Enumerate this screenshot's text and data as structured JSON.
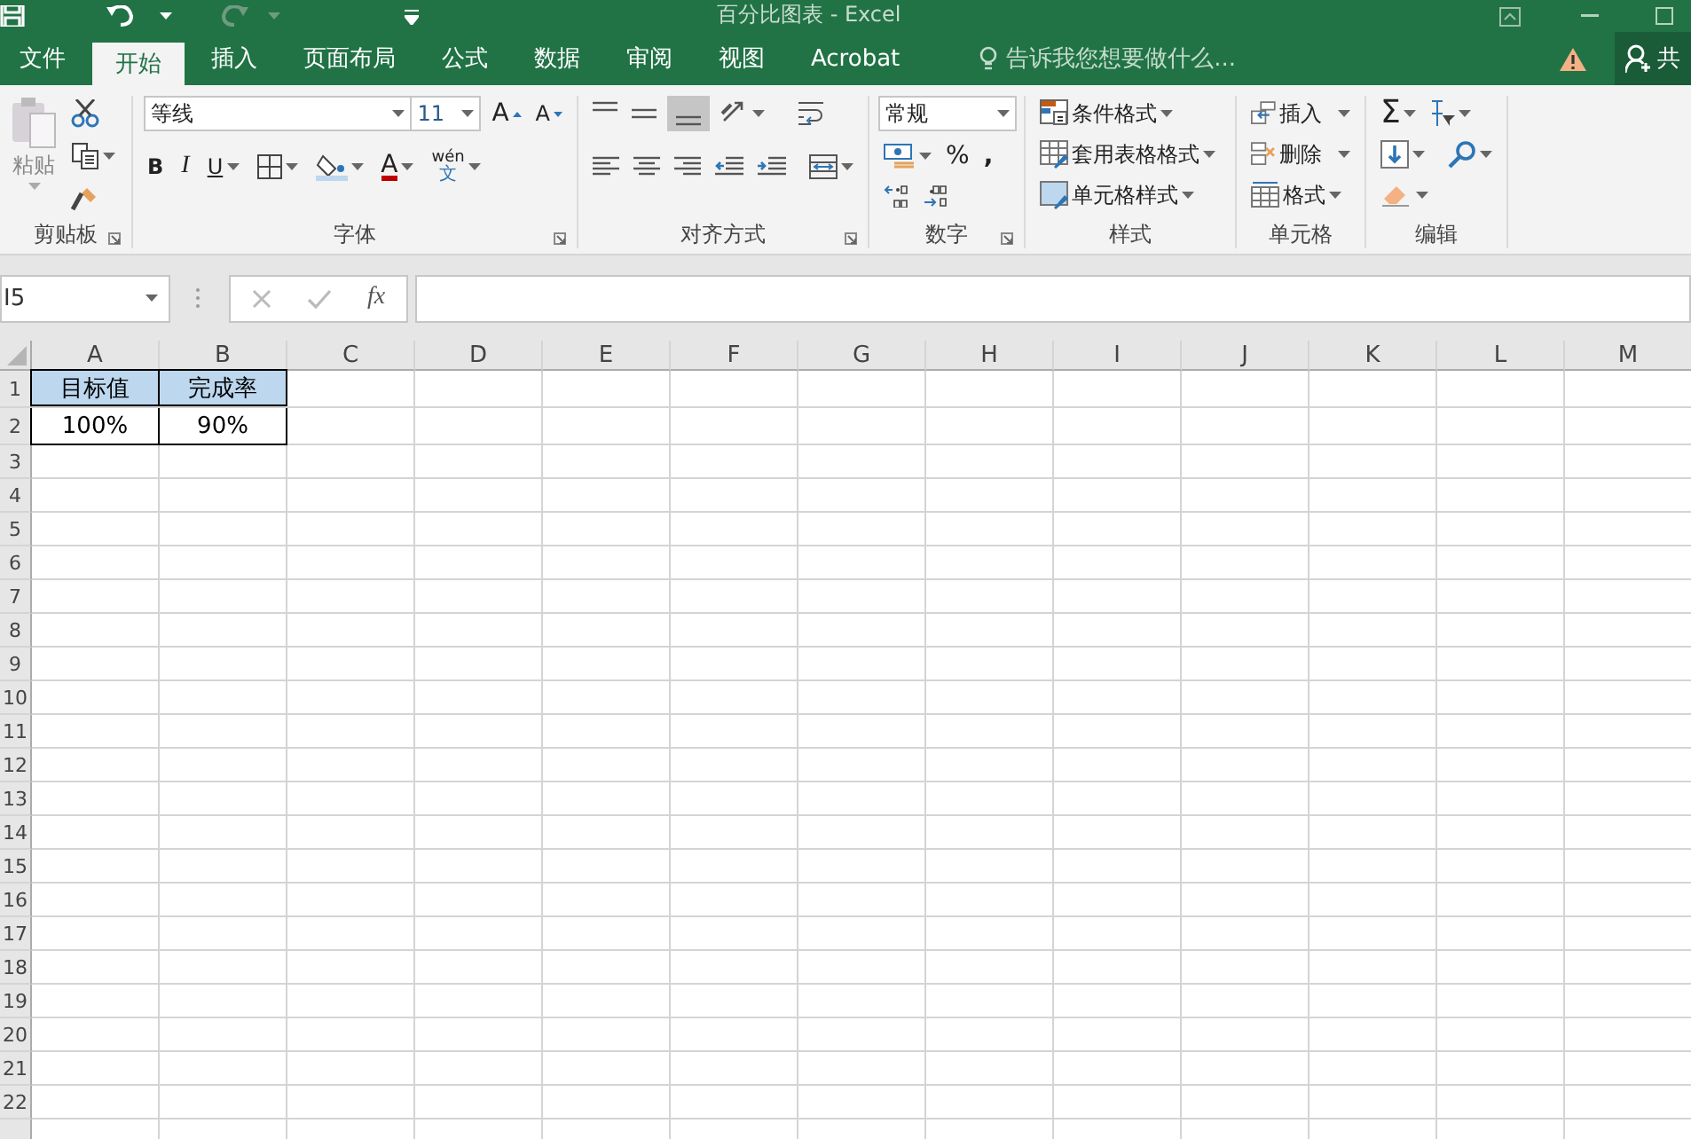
{
  "window": {
    "title": "百分比图表 - Excel"
  },
  "tabs": [
    {
      "label": "文件",
      "selected": false
    },
    {
      "label": "开始",
      "selected": true
    },
    {
      "label": "插入",
      "selected": false
    },
    {
      "label": "页面布局",
      "selected": false
    },
    {
      "label": "公式",
      "selected": false
    },
    {
      "label": "数据",
      "selected": false
    },
    {
      "label": "审阅",
      "selected": false
    },
    {
      "label": "视图",
      "selected": false
    },
    {
      "label": "Acrobat",
      "selected": false
    }
  ],
  "tell_me": {
    "placeholder": "告诉我您想要做什么..."
  },
  "share": {
    "label": "共"
  },
  "ribbon": {
    "clipboard": {
      "label": "剪贴板",
      "paste": "粘贴"
    },
    "font": {
      "label": "字体",
      "name": "等线",
      "size": "11",
      "grow": "A",
      "shrink": "A",
      "bold": "B",
      "italic": "I",
      "underline": "U",
      "font_color": "A",
      "phonetic": "wén",
      "phonetic_char": "文"
    },
    "alignment": {
      "label": "对齐方式"
    },
    "number": {
      "label": "数字",
      "format": "常规",
      "percent": "%",
      "comma": ","
    },
    "styles": {
      "label": "样式",
      "items": [
        "条件格式",
        "套用表格格式",
        "单元格样式"
      ]
    },
    "cells": {
      "label": "单元格",
      "items": [
        "插入",
        "删除",
        "格式"
      ]
    },
    "editing": {
      "label": "编辑",
      "autosum": "Σ"
    }
  },
  "formula_bar": {
    "name_box": "I5",
    "function": "fx"
  },
  "sheet": {
    "columns": [
      "A",
      "B",
      "C",
      "D",
      "E",
      "F",
      "G",
      "H",
      "I",
      "J",
      "K",
      "L",
      "M"
    ],
    "rows": [
      {
        "label": "1",
        "cells": [
          {
            "text": "目标值",
            "highlighted": true
          },
          {
            "text": "完成率",
            "highlighted": true
          }
        ]
      },
      {
        "label": "2",
        "cells": [
          {
            "text": "100%",
            "highlighted": false
          },
          {
            "text": "90%",
            "highlighted": false
          }
        ]
      },
      {
        "label": "3",
        "cells": []
      },
      {
        "label": "4",
        "cells": []
      },
      {
        "label": "5",
        "cells": []
      },
      {
        "label": "6",
        "cells": []
      },
      {
        "label": "7",
        "cells": []
      },
      {
        "label": "8",
        "cells": []
      },
      {
        "label": "9",
        "cells": []
      },
      {
        "label": "10",
        "cells": []
      },
      {
        "label": "11",
        "cells": []
      },
      {
        "label": "12",
        "cells": []
      },
      {
        "label": "13",
        "cells": []
      },
      {
        "label": "14",
        "cells": []
      },
      {
        "label": "15",
        "cells": []
      },
      {
        "label": "16",
        "cells": []
      },
      {
        "label": "17",
        "cells": []
      },
      {
        "label": "18",
        "cells": []
      },
      {
        "label": "19",
        "cells": []
      },
      {
        "label": "20",
        "cells": []
      },
      {
        "label": "21",
        "cells": []
      },
      {
        "label": "22",
        "cells": []
      }
    ]
  }
}
